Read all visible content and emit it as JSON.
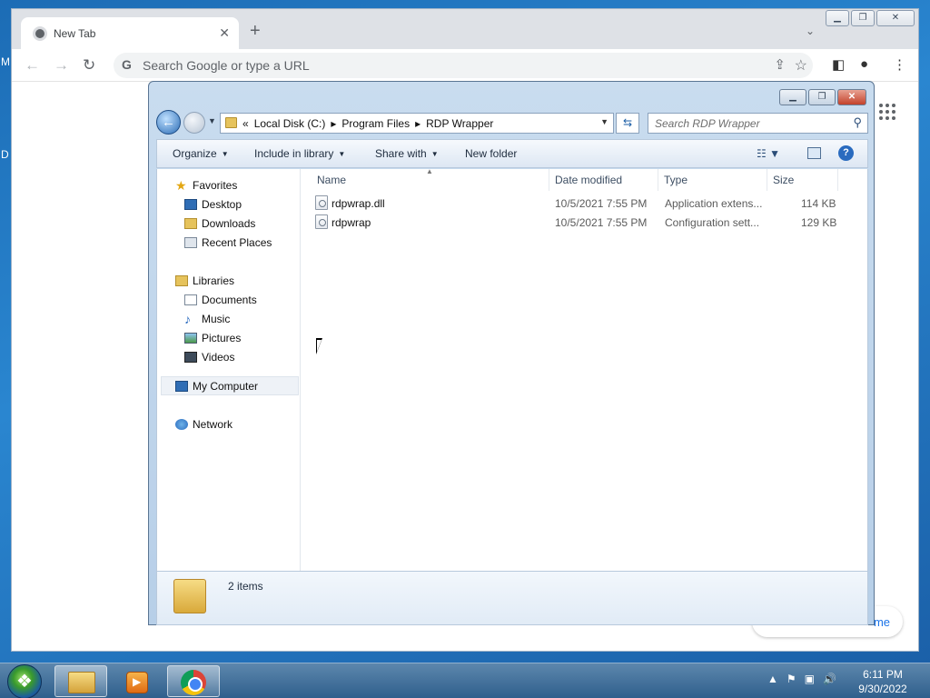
{
  "desktop": {
    "edge_letters": [
      "M",
      "D"
    ]
  },
  "chrome": {
    "tab_title": "New Tab",
    "tab_close": "✕",
    "new_tab": "+",
    "tab_menu": "⌄",
    "omnibox_placeholder": "Search Google or type a URL",
    "customize_fragment": "me",
    "icons": {
      "favicon": "chrome-favicon-icon",
      "back": "back-arrow-icon",
      "forward": "forward-arrow-icon",
      "reload": "reload-icon",
      "google": "google-g-icon",
      "share": "share-icon",
      "star": "star-icon",
      "sidepanel": "side-panel-icon",
      "profile": "profile-icon",
      "menu": "kebab-menu-icon",
      "apps": "apps-grid-icon"
    }
  },
  "explorer": {
    "address": {
      "overflow": "«",
      "crumbs": [
        "Local Disk (C:)",
        "Program Files",
        "RDP Wrapper"
      ],
      "separator": "▸"
    },
    "search_placeholder": "Search RDP Wrapper",
    "commands": {
      "organize": "Organize",
      "include_in_library": "Include in library",
      "share_with": "Share with",
      "new_folder": "New folder"
    },
    "nav": {
      "favorites": "Favorites",
      "desktop": "Desktop",
      "downloads": "Downloads",
      "recent_places": "Recent Places",
      "libraries": "Libraries",
      "documents": "Documents",
      "music": "Music",
      "pictures": "Pictures",
      "videos": "Videos",
      "my_computer": "My Computer",
      "network": "Network"
    },
    "columns": {
      "name": "Name",
      "date": "Date modified",
      "type": "Type",
      "size": "Size"
    },
    "files": [
      {
        "name": "rdpwrap.dll",
        "date": "10/5/2021 7:55 PM",
        "type": "Application extens...",
        "size": "114 KB"
      },
      {
        "name": "rdpwrap",
        "date": "10/5/2021 7:55 PM",
        "type": "Configuration sett...",
        "size": "129 KB"
      }
    ],
    "status_count": "2 items"
  },
  "taskbar": {
    "time": "6:11 PM",
    "date": "9/30/2022",
    "tray_icons": [
      "show-hidden-icons-icon",
      "action-center-icon",
      "network-icon",
      "volume-icon"
    ]
  },
  "colors": {
    "desktop": "#2a86d0",
    "explorer_frame": "#c9dcef",
    "chrome_tabstrip": "#dee1e6",
    "link": "#1a73e8"
  }
}
